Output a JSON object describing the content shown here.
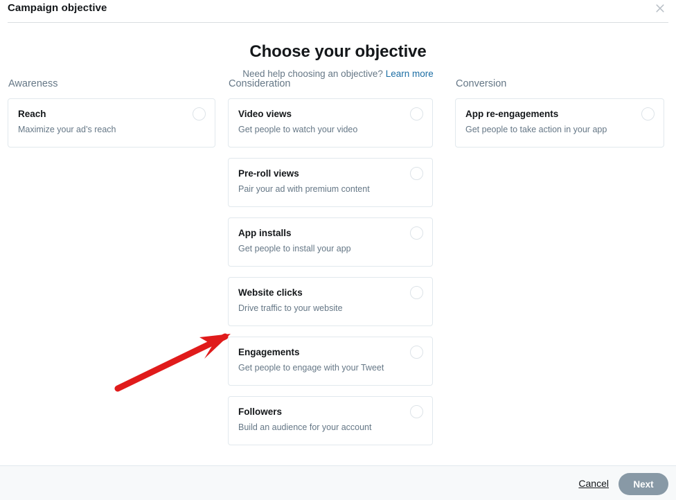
{
  "header": {
    "title": "Campaign objective",
    "close_icon": "close-icon"
  },
  "main": {
    "heading": "Choose your objective",
    "subheading_text": "Need help choosing an objective?",
    "subheading_link": "Learn more"
  },
  "columns": [
    {
      "label": "Awareness",
      "cards": [
        {
          "name": "Reach",
          "desc": "Maximize your ad’s reach",
          "selected": false
        }
      ]
    },
    {
      "label": "Consideration",
      "cards": [
        {
          "name": "Video views",
          "desc": "Get people to watch your video",
          "selected": false
        },
        {
          "name": "Pre-roll views",
          "desc": "Pair your ad with premium content",
          "selected": false
        },
        {
          "name": "App installs",
          "desc": "Get people to install your app",
          "selected": false
        },
        {
          "name": "Website clicks",
          "desc": "Drive traffic to your website",
          "selected": false
        },
        {
          "name": "Engagements",
          "desc": "Get people to engage with your Tweet",
          "selected": false
        },
        {
          "name": "Followers",
          "desc": "Build an audience for your account",
          "selected": false
        }
      ]
    },
    {
      "label": "Conversion",
      "cards": [
        {
          "name": "App re-engagements",
          "desc": "Get people to take action in your app",
          "selected": false
        }
      ]
    }
  ],
  "footer": {
    "cancel_label": "Cancel",
    "next_label": "Next"
  },
  "annotation": {
    "arrow_color": "#e01b1b",
    "points_at": "Website clicks"
  },
  "colors": {
    "link": "#1c6ea4",
    "text_primary": "#14171a",
    "text_secondary": "#657786",
    "border": "#e1e8ed",
    "footer_bg": "#f7f9fa",
    "next_button_bg": "#8899a6",
    "arrow": "#e01b1b"
  }
}
